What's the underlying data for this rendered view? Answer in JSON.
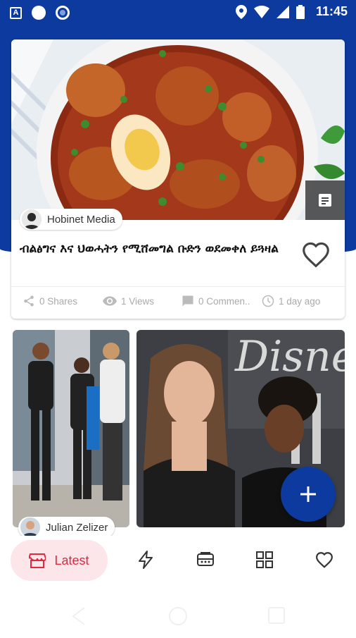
{
  "status_bar": {
    "time": "11:45"
  },
  "featured": {
    "author": "Hobinet Media",
    "title": "ብልፅግና እና ህወሓትን የሚሸመግል ቡድን ወደመቀለ ይጓዛል",
    "shares": "0 Shares",
    "views": "1 Views",
    "comments": "0 Commen..",
    "time_ago": "1 day ago"
  },
  "second_card": {
    "author": "Julian Zelizer"
  },
  "bottom_nav": {
    "latest_label": "Latest",
    "items": [
      "flash-icon",
      "feed-icon",
      "grid-icon",
      "favorite-icon"
    ]
  },
  "colors": {
    "brand": "#0d3a9e",
    "accent": "#e0283e",
    "accent_bg": "#fde6ea"
  }
}
